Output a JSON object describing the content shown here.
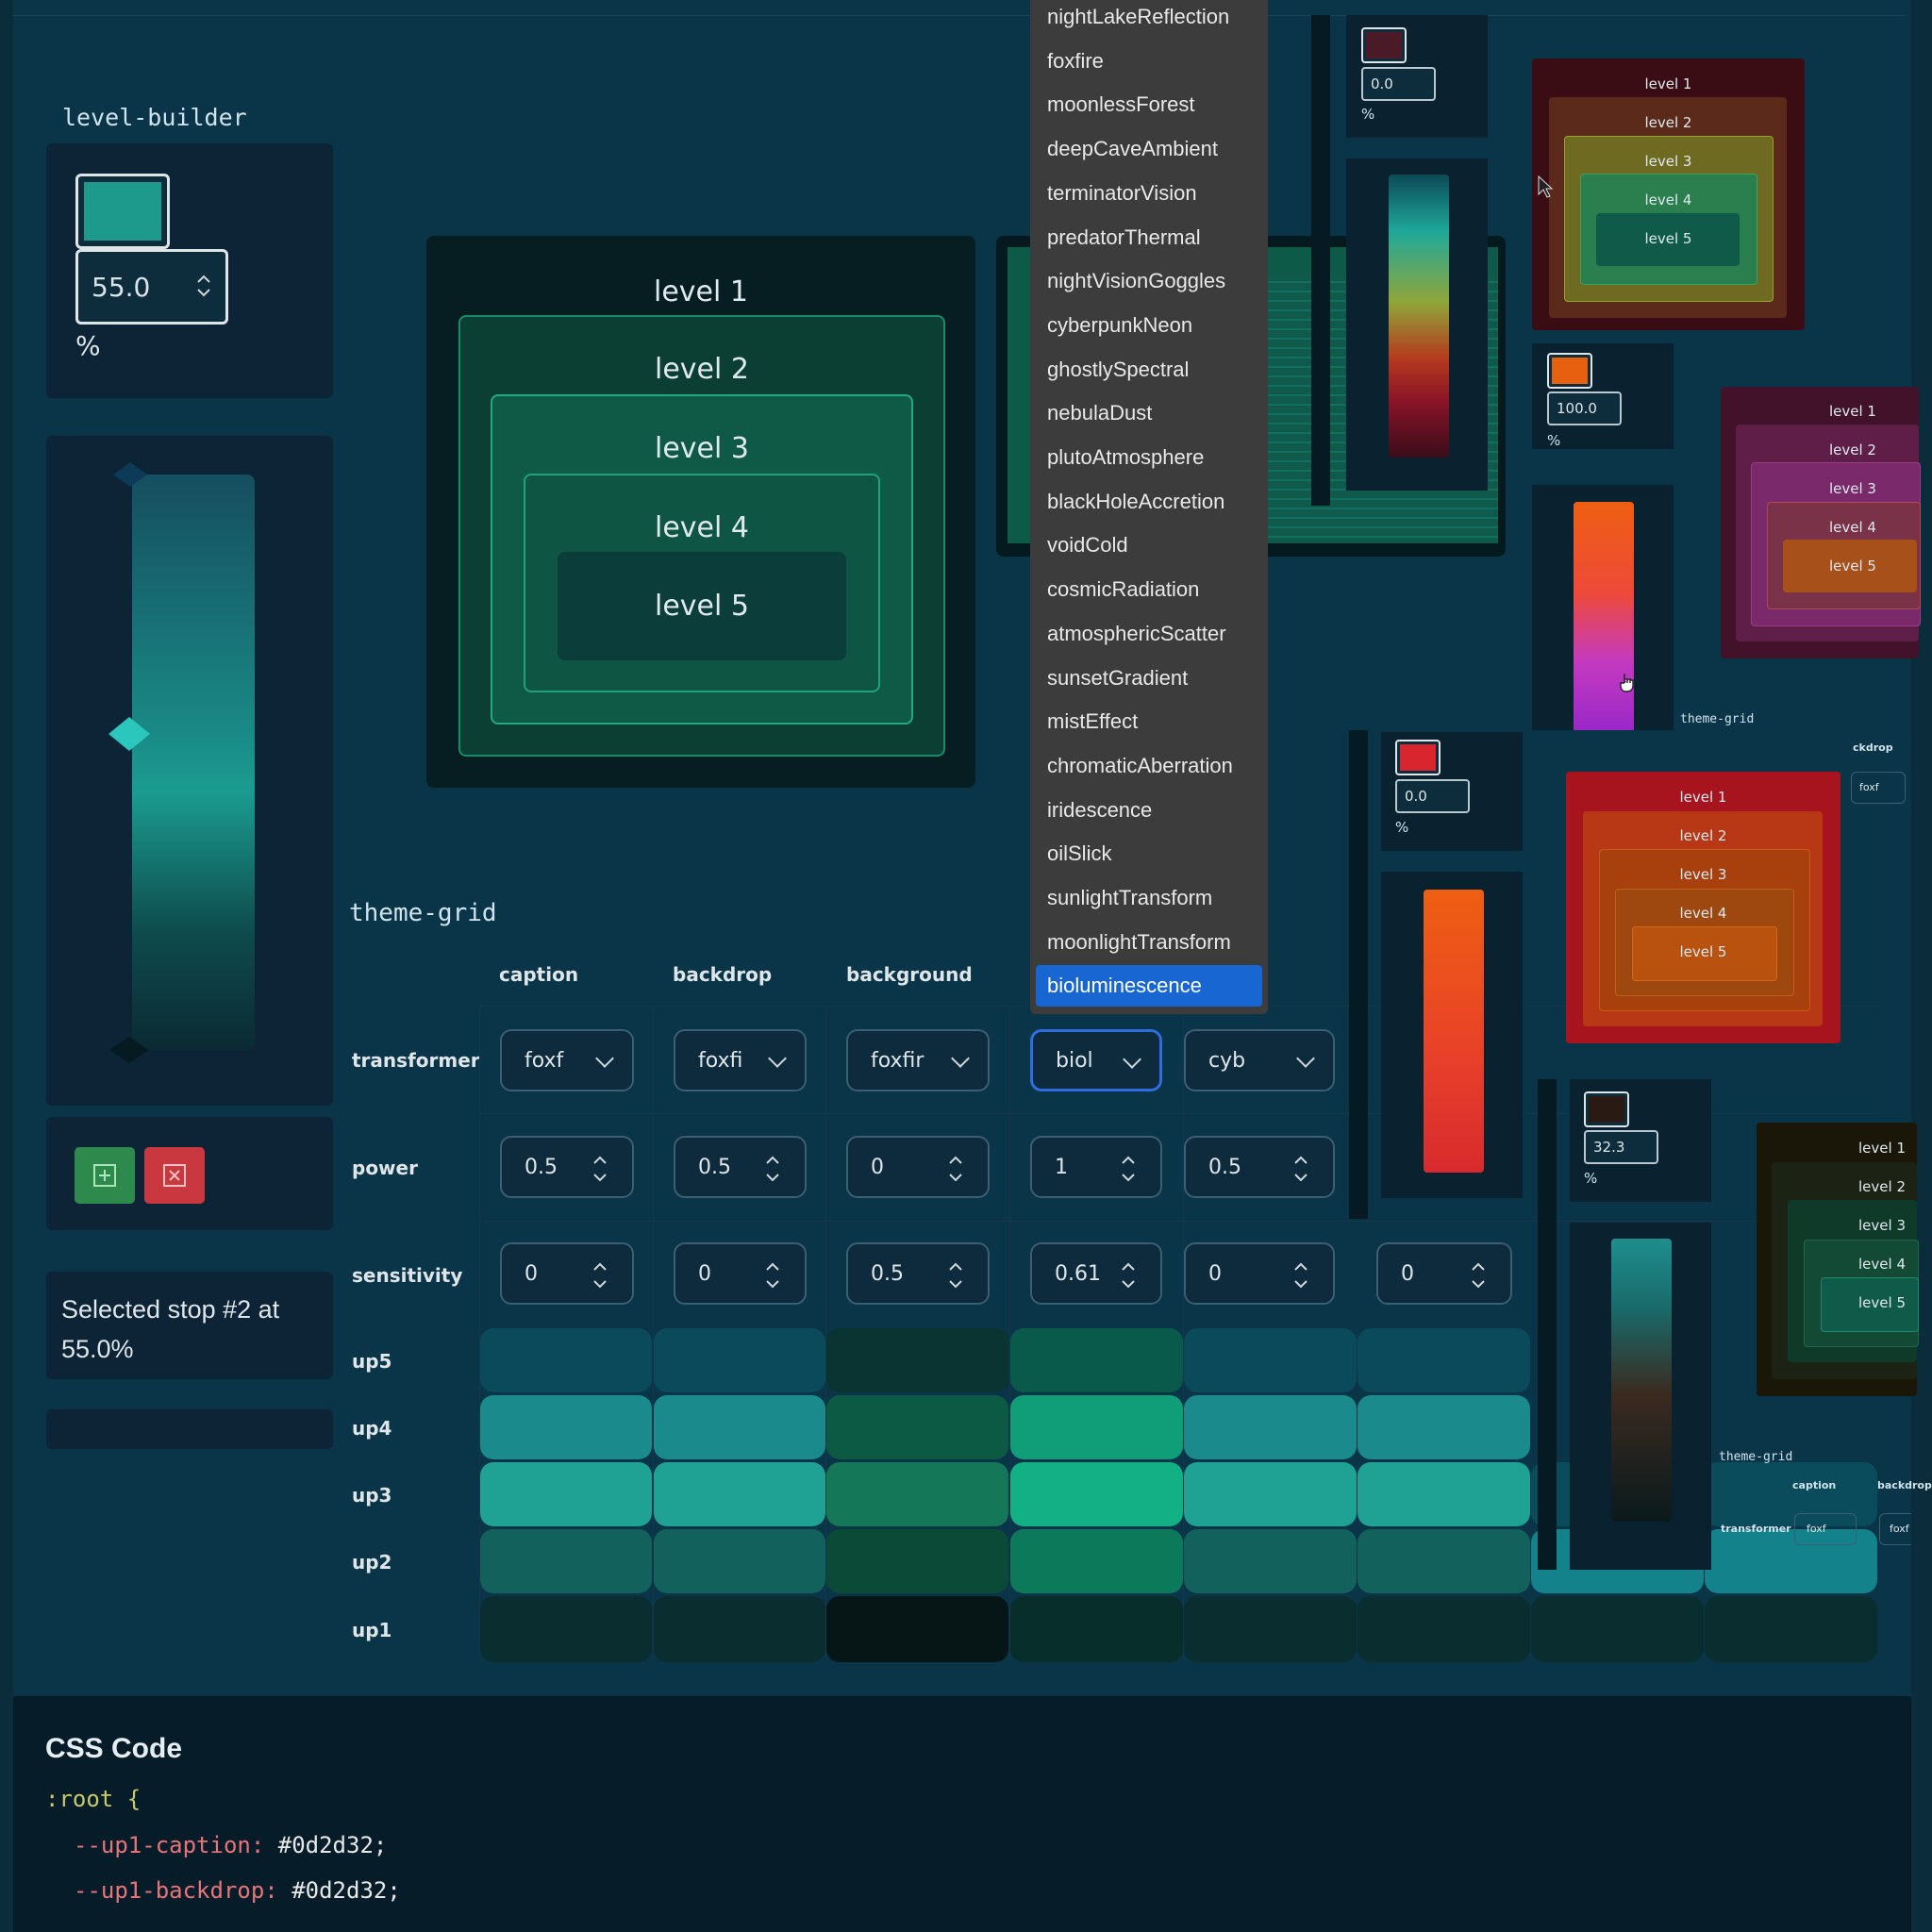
{
  "level_builder": {
    "title": "level-builder",
    "value": "55.0",
    "unit": "%",
    "swatch_color": "#1e9a8c",
    "add_label": "+",
    "delete_label": "×",
    "status": "Selected stop #2 at 55.0%"
  },
  "levels": [
    "level 1",
    "level 2",
    "level 3",
    "level 4",
    "level 5"
  ],
  "theme_grid": {
    "title": "theme-grid",
    "columns": [
      "caption",
      "backdrop",
      "background"
    ],
    "rows": [
      "transformer",
      "power",
      "sensitivity",
      "up5",
      "up4",
      "up3",
      "up2",
      "up1"
    ],
    "transformers": [
      "foxf",
      "foxfi",
      "foxfir",
      "biol",
      "cyb"
    ],
    "power": [
      "0.5",
      "0.5",
      "0",
      "1",
      "0.5"
    ],
    "sensitivity": [
      "0",
      "0",
      "0.5",
      "0.61",
      "0",
      "0"
    ]
  },
  "dropdown": {
    "options": [
      "nightLakeReflection",
      "foxfire",
      "moonlessForest",
      "deepCaveAmbient",
      "terminatorVision",
      "predatorThermal",
      "nightVisionGoggles",
      "cyberpunkNeon",
      "ghostlySpectral",
      "nebulaDust",
      "plutoAtmosphere",
      "blackHoleAccretion",
      "voidCold",
      "cosmicRadiation",
      "atmosphericScatter",
      "sunsetGradient",
      "mistEffect",
      "chromaticAberration",
      "iridescence",
      "oilSlick",
      "sunlightTransform",
      "moonlightTransform",
      "bioluminescence"
    ],
    "selected": "bioluminescence"
  },
  "css_code": {
    "title": "CSS Code",
    "line1": ":root {",
    "line2_var": "--up1-caption:",
    "line2_val": "#0d2d32;",
    "line3_var": "--up1-backdrop:",
    "line3_val": "#0d2d32;"
  },
  "mini_panels": {
    "a_value": "0.0",
    "a_unit": "%",
    "b_value": "100.0",
    "b_unit": "%",
    "c_value": "0.0",
    "c_unit": "%",
    "d_value": "32.3",
    "d_unit": "%",
    "theme_grid_small": "theme-grid",
    "theme_grid_small_2": "theme-grid",
    "small_caption": "caption",
    "small_backdrop": "backdrop",
    "small_transformer": "transformer",
    "small_foxf": "foxf",
    "small_foxf_2": "foxf",
    "small_ckdrop": "ckdrop",
    "small_foxf_3": "foxf"
  },
  "colors": {
    "page_bg": "#0a3447",
    "accent": "#1e9a8c",
    "selection": "#1766d1",
    "dropdown_bg": "#3c3c3c",
    "add_button": "#2d8a4c",
    "delete_button": "#c9383e"
  }
}
